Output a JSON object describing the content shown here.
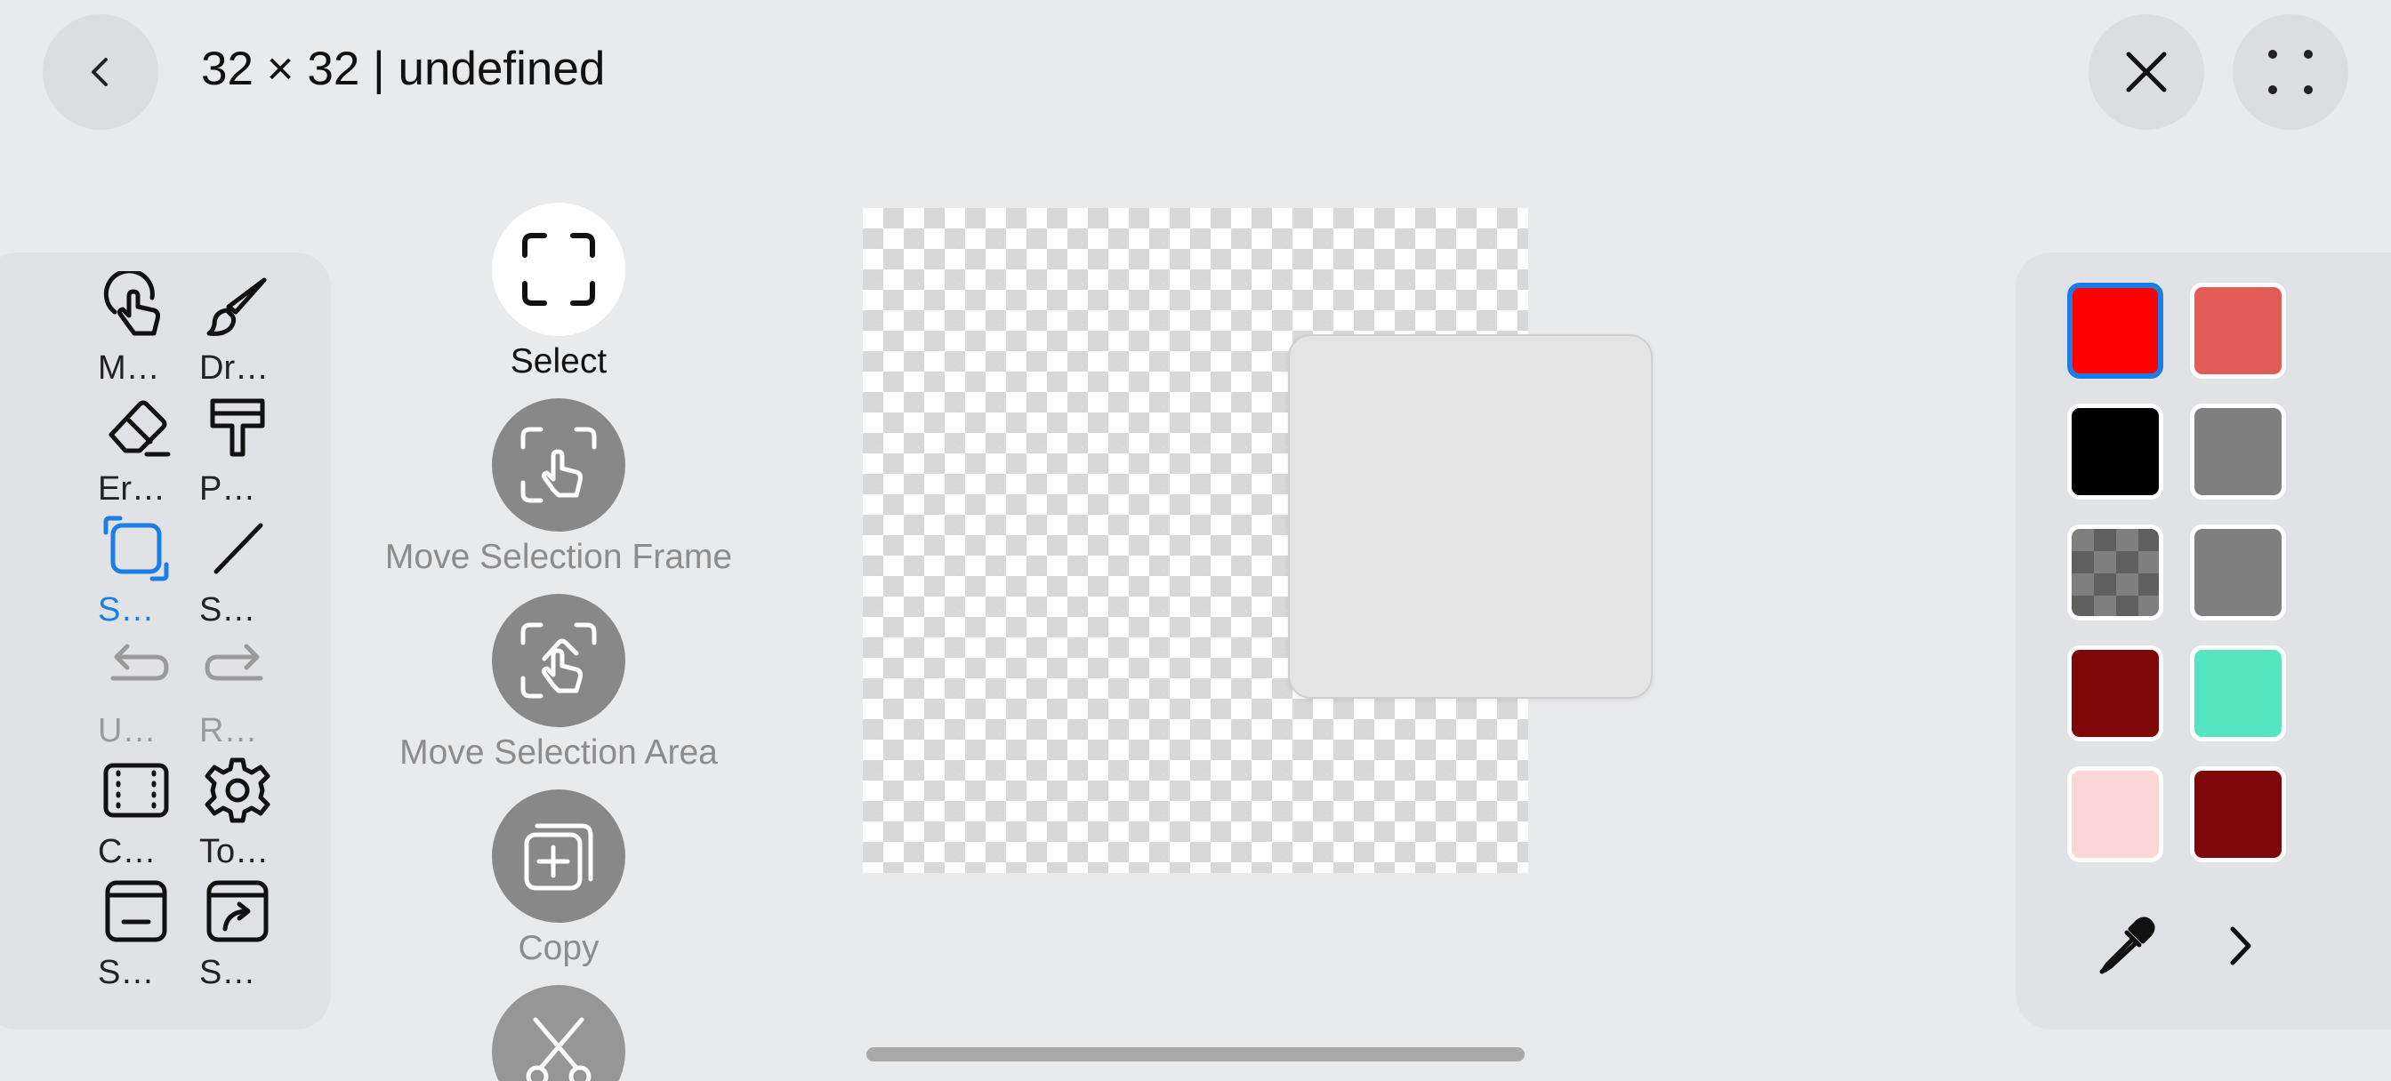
{
  "header": {
    "title": "32 × 32 |  undefined",
    "back_icon": "chevron-left-icon",
    "close_icon": "close-icon",
    "more_icon": "grid-dots-icon"
  },
  "tools": [
    {
      "label": "M…",
      "icon": "hand-pointer-icon"
    },
    {
      "label": "Dr…",
      "icon": "brush-icon"
    },
    {
      "label": "Er…",
      "icon": "eraser-icon"
    },
    {
      "label": "P…",
      "icon": "paint-bucket-icon"
    },
    {
      "label": "S…",
      "icon": "select-square-icon",
      "active": true
    },
    {
      "label": "S…",
      "icon": "line-icon"
    },
    {
      "label": "U…",
      "icon": "undo-icon"
    },
    {
      "label": "R…",
      "icon": "redo-icon"
    },
    {
      "label": "C…",
      "icon": "canvas-frame-icon"
    },
    {
      "label": "To…",
      "icon": "gear-icon"
    },
    {
      "label": "S…",
      "icon": "save-icon"
    },
    {
      "label": "S…",
      "icon": "save-as-icon"
    }
  ],
  "sub_tools": [
    {
      "label": "Select",
      "icon": "select-frame-icon"
    },
    {
      "label": "Move Selection Frame",
      "icon": "move-frame-icon"
    },
    {
      "label": "Move Selection Area",
      "icon": "move-area-icon"
    },
    {
      "label": "Copy",
      "icon": "copy-icon"
    },
    {
      "label": "",
      "icon": "cut-icon"
    }
  ],
  "palette": {
    "colors": [
      "#ff0000",
      "#e35b57",
      "#000000",
      "#7f7f7f",
      "checker",
      "#7f7f7f",
      "#800707",
      "#55e6c1",
      "#fdd6d8",
      "#800707"
    ],
    "selected_index": 0,
    "eyedropper_icon": "eyedropper-icon",
    "next_icon": "chevron-right-icon"
  }
}
